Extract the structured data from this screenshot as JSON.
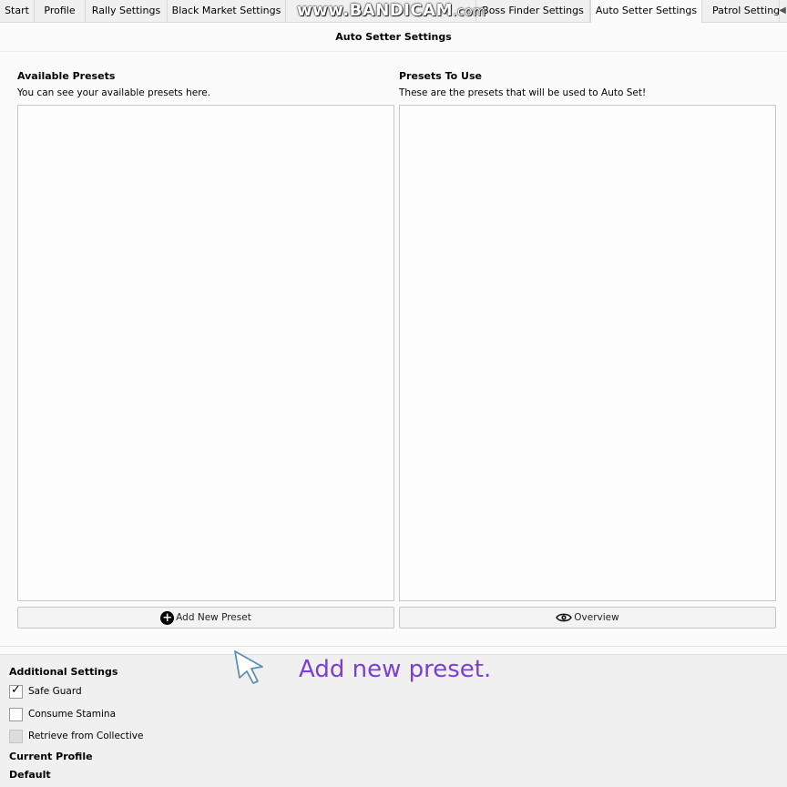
{
  "tabs": [
    {
      "label": "Start",
      "active": false
    },
    {
      "label": "Profile",
      "active": false
    },
    {
      "label": "Rally Settings",
      "active": false
    },
    {
      "label": "Black Market Settings",
      "active": false
    },
    {
      "label": "",
      "active": false
    },
    {
      "label": "Boss Finder Settings",
      "active": false
    },
    {
      "label": "Auto Setter Settings",
      "active": true
    },
    {
      "label": "Patrol Settings",
      "active": false
    }
  ],
  "watermark": {
    "main": "www.BANDICAM",
    "suffix": ".com"
  },
  "panel": {
    "title": "Auto Setter Settings",
    "available": {
      "heading": "Available Presets",
      "description": "You can see your available presets here.",
      "button_label": "Add New Preset",
      "button_icon": "plus-circle-icon"
    },
    "to_use": {
      "heading": "Presets To Use",
      "description": "These are the presets that will be used to Auto Set!",
      "button_label": "Overview",
      "button_icon": "eye-icon"
    }
  },
  "additional": {
    "title": "Additional Settings",
    "options": [
      {
        "label": "Safe Guard",
        "checked": true,
        "enabled": true
      },
      {
        "label": "Consume Stamina",
        "checked": false,
        "enabled": true
      },
      {
        "label": "Retrieve from Collective",
        "checked": false,
        "enabled": false
      }
    ]
  },
  "profile": {
    "label": "Current Profile",
    "value": "Default"
  },
  "annotation": {
    "text": "Add new preset.",
    "color": "#7b3fd6"
  }
}
